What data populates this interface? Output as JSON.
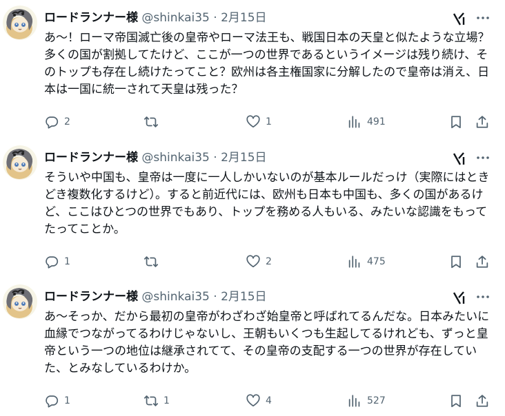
{
  "tweets": [
    {
      "name": "ロードランナー様",
      "handle": "@shinkai35",
      "separator": "·",
      "date": "2月15日",
      "text": "あ～！ローマ帝国滅亡後の皇帝やローマ法王も、戦国日本の天皇と似たような立場？多くの国が割拠してたけど、ここが一つの世界であるというイメージは残り続け、そのトップも存在し続けたってこと？欧州は各主権国家に分解したので皇帝は消え、日本は一国に統一されて天皇は残った？",
      "replies": "2",
      "reposts": "",
      "likes": "1",
      "views": "491"
    },
    {
      "name": "ロードランナー様",
      "handle": "@shinkai35",
      "separator": "·",
      "date": "2月15日",
      "text": "そういや中国も、皇帝は一度に一人しかいないのが基本ルールだっけ（実際にはときどき複数化するけど）。すると前近代には、欧州も日本も中国も、多くの国があるけど、ここはひとつの世界でもあり、トップを務める人もいる、みたいな認識をもってたってことか。",
      "replies": "1",
      "reposts": "",
      "likes": "2",
      "views": "475"
    },
    {
      "name": "ロードランナー様",
      "handle": "@shinkai35",
      "separator": "·",
      "date": "2月15日",
      "text": "あ～そっか、だから最初の皇帝がわざわざ始皇帝と呼ばれてるんだな。日本みたいに血縁でつながってるわけじゃないし、王朝もいくつも生起してるけれども、ずっと皇帝という一つの地位は継承されてて、その皇帝の支配する一つの世界が存在していた、とみなしているわけか。",
      "replies": "1",
      "reposts": "1",
      "likes": "4",
      "views": "527"
    }
  ],
  "icons": [
    "avatar",
    "grok-icon",
    "more-icon",
    "reply-icon",
    "repost-icon",
    "like-icon",
    "views-icon",
    "bookmark-icon",
    "share-icon"
  ],
  "colors": {
    "text": "#0f1419",
    "muted": "#536471",
    "background": "#ffffff"
  }
}
